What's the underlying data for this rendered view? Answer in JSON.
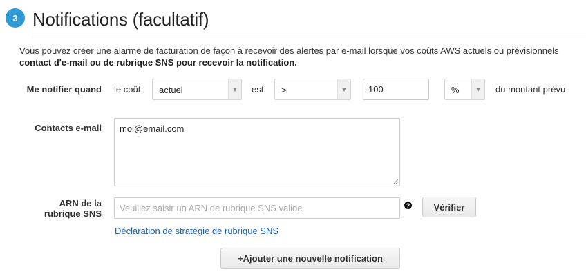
{
  "section": {
    "step_number": "3",
    "title": "Notifications (facultatif)",
    "description_line1": "Vous pouvez créer une alarme de facturation de façon à recevoir des alertes par e-mail lorsque vos coûts AWS actuels ou prévisionnels",
    "description_line2": "contact d'e-mail ou de rubrique SNS pour recevoir la notification."
  },
  "condition": {
    "label": "Me notifier quand",
    "text_cost": "le coût",
    "cost_type_selected": "actuel",
    "text_is": "est",
    "operator_selected": ">",
    "threshold_value": "100",
    "unit_selected": "%",
    "text_suffix": "du montant prévu"
  },
  "email": {
    "label": "Contacts e-mail",
    "value": "moi@email.com"
  },
  "sns": {
    "label_line1": "ARN de la",
    "label_line2": "rubrique SNS",
    "placeholder": "Veuillez saisir un ARN de rubrique SNS valide",
    "verify_label": "Vérifier",
    "help_icon": "question-icon",
    "policy_link": "Déclaration de stratégie de rubrique SNS"
  },
  "actions": {
    "add_notification_label": "+Ajouter une nouvelle notification"
  },
  "colors": {
    "badge": "#2e9ad6",
    "link": "#1f5fa8"
  }
}
